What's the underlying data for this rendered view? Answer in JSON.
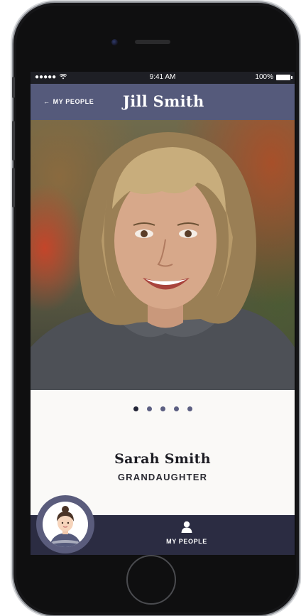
{
  "status_bar": {
    "signal": "●●●●●",
    "wifi_icon": "wifi-icon",
    "time": "9:41 AM",
    "battery_percent": "100%"
  },
  "nav": {
    "back_arrow": "←",
    "back_label": "MY PEOPLE",
    "title": "Jill Smith"
  },
  "photo": {
    "pagination_total": 5,
    "pagination_active": 1
  },
  "person": {
    "name": "Sarah Smith",
    "relation": "GRANDAUGHTER"
  },
  "tabbar": {
    "my_people_label": "MY PEOPLE",
    "my_people_icon": "person-icon",
    "avatar_icon": "user-avatar"
  },
  "colors": {
    "nav_bg": "#555a7b",
    "tab_bg": "#2b2c42",
    "status_bg": "#1e1f25",
    "active_dot": "#222436",
    "dot": "#5c5f82"
  }
}
